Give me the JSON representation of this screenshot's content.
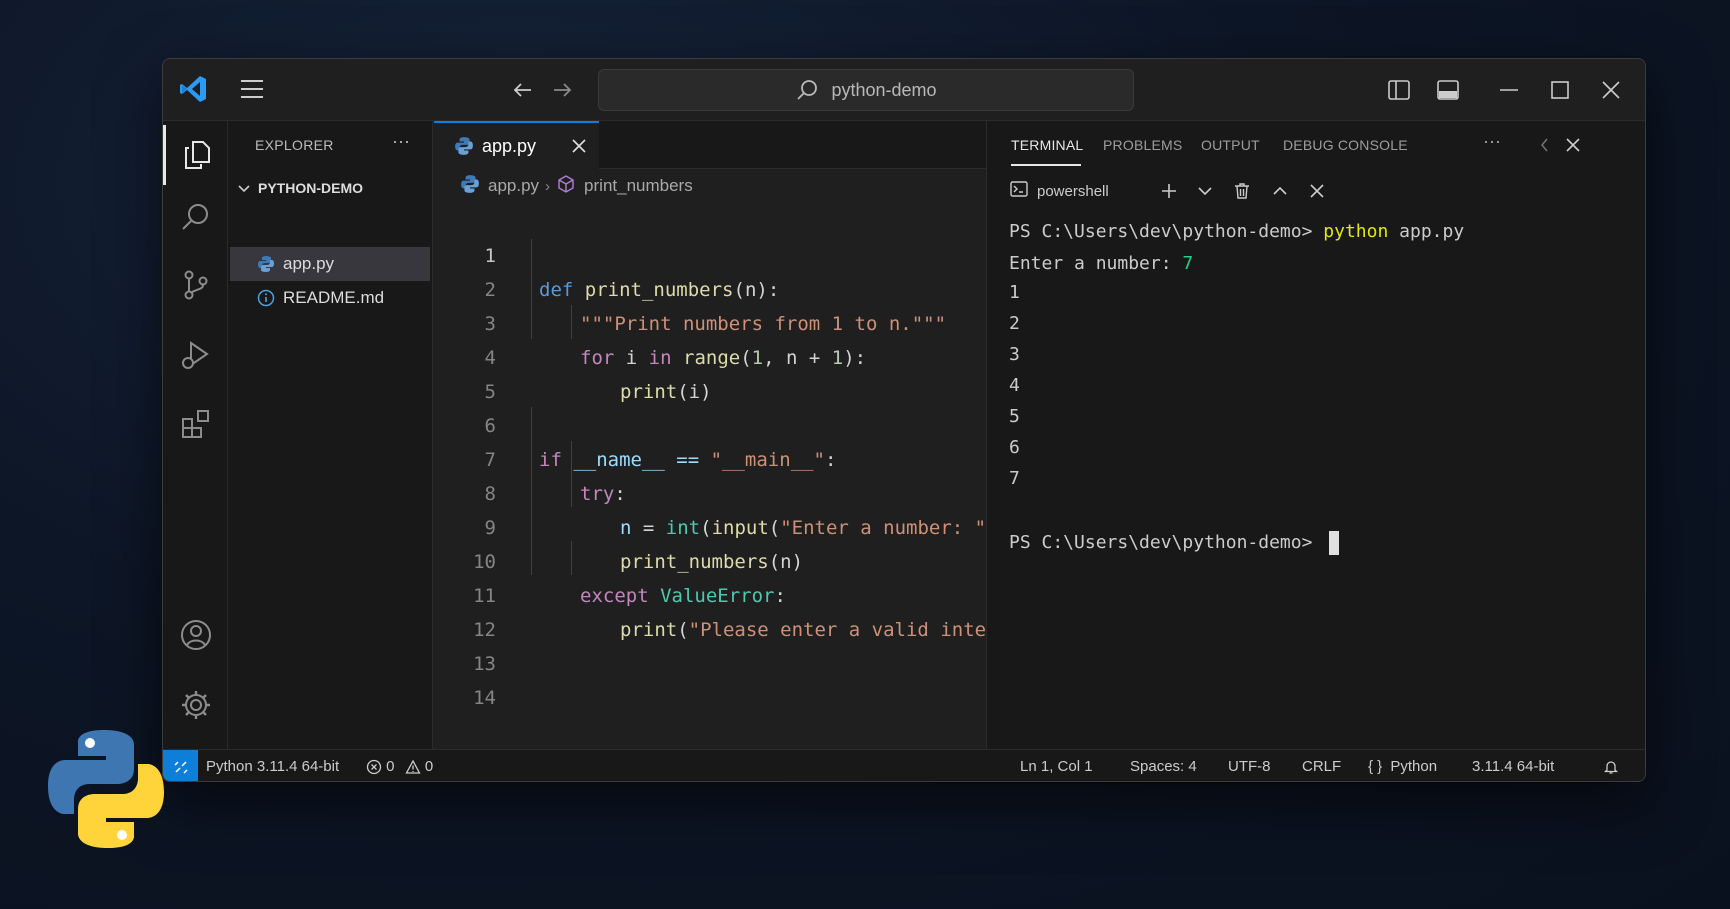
{
  "titlebar": {
    "search_text": "python-demo"
  },
  "sidebar": {
    "title": "EXPLORER",
    "more": "···",
    "folder": "PYTHON-DEMO",
    "files": [
      {
        "name": "app.py",
        "icon": "python-file-icon",
        "selected": true
      },
      {
        "name": "README.md",
        "icon": "info-icon",
        "selected": false
      }
    ]
  },
  "editor": {
    "tab": {
      "label": "app.py"
    },
    "breadcrumb": {
      "file": "app.py",
      "symbol": "print_numbers"
    },
    "line_numbers": [
      "1",
      "2",
      "3",
      "4",
      "5",
      "6",
      "7",
      "8",
      "9",
      "10",
      "11",
      "12",
      "13",
      "14"
    ],
    "code": {
      "l1": [
        "def",
        "print_numbers",
        "(n):"
      ],
      "l2": "\"\"\"Print numbers from 1 to n.\"\"\"",
      "l3": [
        "for",
        " i ",
        "in",
        "range",
        "(",
        "1",
        ", n + ",
        "1",
        "):"
      ],
      "l4": [
        "print",
        "(i)"
      ],
      "l6": [
        "if",
        " __name__ == ",
        "\"__main__\"",
        ":"
      ],
      "l7": [
        "try",
        ":"
      ],
      "l8": [
        "n",
        " = ",
        "int",
        "(",
        "input",
        "(",
        "\"Enter a number: \"",
        "))"
      ],
      "l9": [
        "print_numbers",
        "(n)"
      ],
      "l10": [
        "except",
        " ",
        "ValueError",
        ":"
      ],
      "l11": [
        "print",
        "(",
        "\"Please enter a valid integer.\"",
        ")"
      ]
    }
  },
  "panel": {
    "tabs": [
      "TERMINAL",
      "PROBLEMS",
      "OUTPUT",
      "DEBUG CONSOLE"
    ],
    "more": "···",
    "shell": "powershell",
    "terminal": {
      "prompt1": "PS C:\\Users\\dev\\python-demo> ",
      "cmd1": "python",
      "args1": " app.py",
      "input_prompt": "Enter a number: ",
      "input_value": "7",
      "outputs": [
        "1",
        "2",
        "3",
        "4",
        "5",
        "6",
        "7"
      ],
      "prompt2": "PS C:\\Users\\dev\\python-demo> "
    }
  },
  "statusbar": {
    "interpreter": "Python 3.11.4 64-bit",
    "errors": "0",
    "warnings": "0",
    "position": "Ln 1, Col 1",
    "spaces": "Spaces: 4",
    "encoding": "UTF-8",
    "eol": "CRLF",
    "language": "Python",
    "version": "3.11.4 64-bit"
  },
  "colors": {
    "accent": "#0e7fd8",
    "keyword": "#c586c0",
    "declaration": "#569cd6",
    "function": "#dcdcaa",
    "string": "#ce9178",
    "number": "#b5cea8",
    "class": "#4ec9b0",
    "terminal_command": "#e5e510",
    "terminal_input": "#23d18b"
  }
}
